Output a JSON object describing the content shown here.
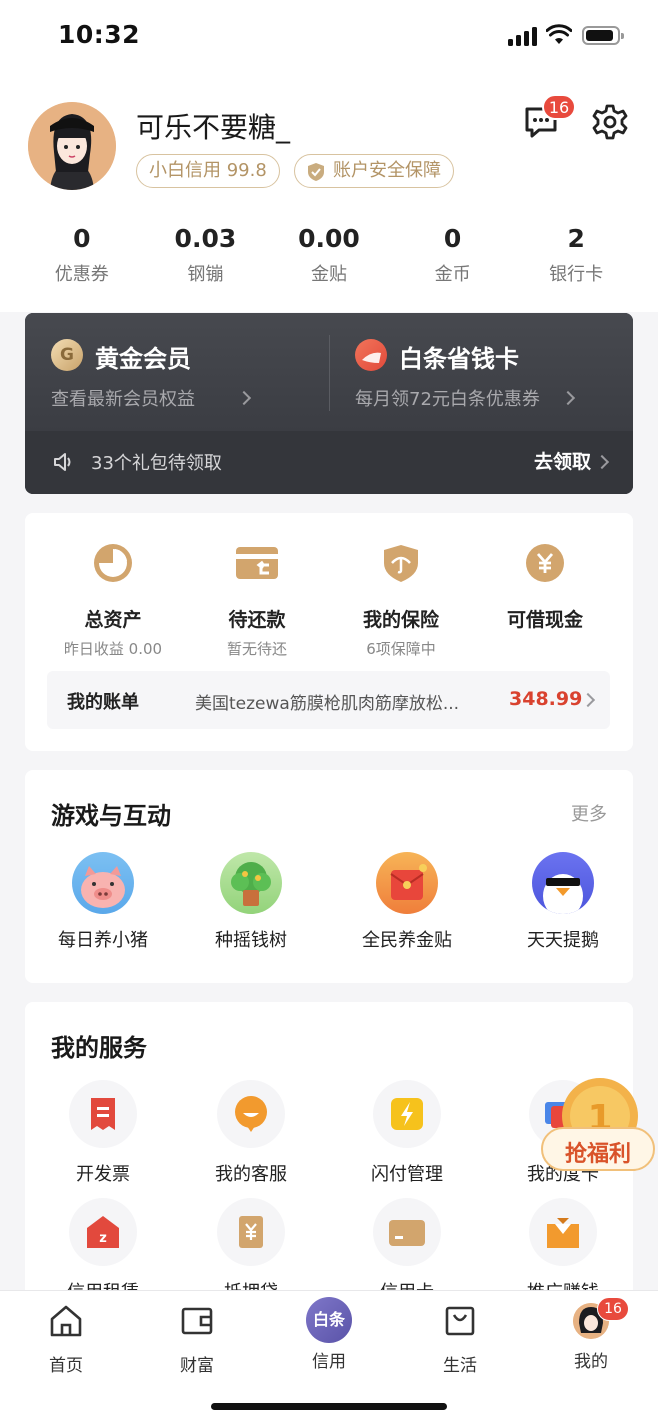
{
  "status_bar": {
    "time": "10:32"
  },
  "profile": {
    "username": "可乐不要糖_",
    "credit_badge": "小白信用 99.8",
    "safety_badge": "账户安全保障",
    "message_count": "16"
  },
  "stats": [
    {
      "value": "0",
      "label": "优惠券"
    },
    {
      "value": "0.03",
      "label": "钢镚"
    },
    {
      "value": "0.00",
      "label": "金贴"
    },
    {
      "value": "0",
      "label": "金币"
    },
    {
      "value": "2",
      "label": "银行卡"
    }
  ],
  "member_card": {
    "gold": {
      "title": "黄金会员",
      "subtitle": "查看最新会员权益",
      "icon_letter": "G"
    },
    "baitiao": {
      "title": "白条省钱卡",
      "subtitle": "每月领72元白条优惠券"
    },
    "gift_text": "33个礼包待领取",
    "claim_label": "去领取"
  },
  "assets": [
    {
      "title": "总资产",
      "sub": "昨日收益 0.00",
      "icon": "pie-chart-icon"
    },
    {
      "title": "待还款",
      "sub": "暂无待还",
      "icon": "card-return-icon"
    },
    {
      "title": "我的保险",
      "sub": "6项保障中",
      "icon": "umbrella-shield-icon"
    },
    {
      "title": "可借现金",
      "sub": "",
      "icon": "yen-coin-icon"
    }
  ],
  "bill": {
    "label": "我的账单",
    "desc": "美国tezewa筋膜枪肌肉筋摩放松...",
    "amount": "348.99"
  },
  "games": {
    "title": "游戏与互动",
    "more": "更多",
    "items": [
      {
        "label": "每日养小猪",
        "icon": "pig-icon"
      },
      {
        "label": "种摇钱树",
        "icon": "money-tree-icon"
      },
      {
        "label": "全民养金贴",
        "icon": "red-envelope-icon"
      },
      {
        "label": "天天提鹅",
        "icon": "goose-icon"
      }
    ]
  },
  "services": {
    "title": "我的服务",
    "items": [
      {
        "label": "开发票",
        "icon": "invoice-icon"
      },
      {
        "label": "我的客服",
        "icon": "customer-service-icon"
      },
      {
        "label": "闪付管理",
        "icon": "quick-pay-icon"
      },
      {
        "label": "我的度卡",
        "icon": "card-icon"
      },
      {
        "label": "信用租赁",
        "icon": "rental-icon"
      },
      {
        "label": "抵押贷",
        "icon": "mortgage-loan-icon"
      },
      {
        "label": "信用卡",
        "icon": "credit-card-icon"
      },
      {
        "label": "推广赚钱",
        "icon": "promote-icon"
      }
    ]
  },
  "promo": {
    "label": "抢福利"
  },
  "tabbar": {
    "items": [
      {
        "label": "首页"
      },
      {
        "label": "财富"
      },
      {
        "label": "信用",
        "icon_text": "白条"
      },
      {
        "label": "生活"
      },
      {
        "label": "我的"
      }
    ],
    "me_badge": "16"
  },
  "colors": {
    "gold": "#c9a26b",
    "dark_card": "#3d3f45",
    "price_red": "#d9422f",
    "badge_red": "#e84a3d"
  }
}
